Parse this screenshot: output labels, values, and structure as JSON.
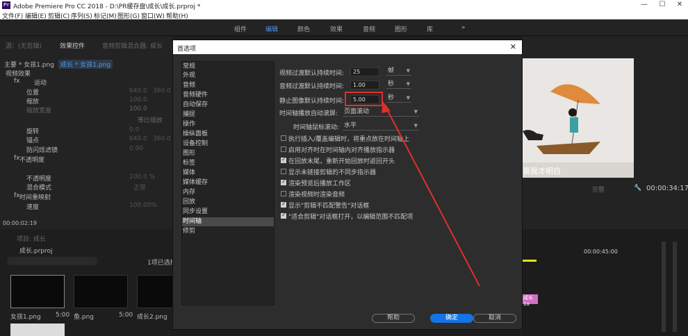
{
  "app": {
    "title": "Adobe Premiere Pro CC 2018 - D:\\PR缓存盘\\成长\\成长.prproj *",
    "logo": "Pr",
    "min": "—",
    "max": "☐",
    "close": "✕"
  },
  "menu": [
    "文件(F)",
    "编辑(E)",
    "剪辑(C)",
    "序列(S)",
    "标记(M)",
    "图形(G)",
    "窗口(W)",
    "帮助(H)"
  ],
  "workspaces": [
    "组件",
    "编辑",
    "颜色",
    "效果",
    "音频",
    "图形",
    "库"
  ],
  "workspace_more": "»",
  "effects_panel": {
    "tab1": "源：(无剪辑)",
    "tab2": "效果控件",
    "tab3": "音频剪辑混合器: 成长",
    "seq_label": "主要 * 女孩1.png",
    "seq_clip": "成长 * 女孩1.png",
    "video_effects": "视频效果",
    "motion": "运动",
    "position": "位置",
    "pos_x": "640.0",
    "pos_y": "360.0",
    "scale": "缩放",
    "scale_v": "100.0",
    "scale_w": "缩放宽度",
    "scale_w_v": "100.0",
    "uniform": "等比缩放",
    "rotation": "旋转",
    "rot_v": "0.0",
    "anchor": "锚点",
    "anc_x": "640.0",
    "anc_y": "360.0",
    "flicker": "防闪烁滤镜",
    "flick_v": "0.00",
    "opacity": "不透明度",
    "opacity_sub": "不透明度",
    "opacity_v": "100.0 %",
    "blend": "混合模式",
    "blend_v": "正常",
    "time_remap": "时间重映射",
    "speed": "速度",
    "speed_v": "100.00%",
    "timecode": "00:00:02:19"
  },
  "project_panel": {
    "tab": "项目: 成长",
    "name": "成长.prproj",
    "selected": "1项已选择",
    "clips": [
      {
        "name": "女孩1.png",
        "dur": "5:00"
      },
      {
        "name": "鱼.png",
        "dur": "5:00"
      },
      {
        "name": "成长2.png",
        "dur": "5:00"
      }
    ]
  },
  "program": {
    "subtitle": "喜我才明白",
    "timecode": "00:00:34:17",
    "fit": "完整",
    "ruler": "00:00:45:00",
    "clip_label": "成长1a"
  },
  "dialog": {
    "title": "首选项",
    "close": "✕",
    "categories": [
      "常规",
      "外观",
      "音频",
      "音频硬件",
      "自动保存",
      "捕捉",
      "操作",
      "操纵面板",
      "设备控制",
      "图形",
      "标签",
      "媒体",
      "媒体缓存",
      "内存",
      "回放",
      "同步设置",
      "时间轴",
      "修剪"
    ],
    "selected_category": "时间轴",
    "settings": {
      "video_transition_label": "视频过渡默认持续时间:",
      "video_transition_value": "25",
      "video_transition_unit": "帧",
      "audio_transition_label": "音频过渡默认持续时间:",
      "audio_transition_value": "1.00",
      "audio_transition_unit": "秒",
      "still_image_label": "静止图像默认持续时间:",
      "still_image_value": "5.00",
      "still_image_unit": "秒",
      "auto_scroll_label": "时间轴播放自动滚屏:",
      "auto_scroll_value": "页面滚动",
      "mouse_scroll_label": "时间轴鼠标滚动:",
      "mouse_scroll_value": "水平"
    },
    "checkboxes": [
      {
        "label": "执行插入/覆盖编辑时，将重点放在时间轴上",
        "checked": false
      },
      {
        "label": "启用对齐时在时间轴内对齐播放指示器",
        "checked": false
      },
      {
        "label": "在回放末尾，重新开始回放时返回开头",
        "checked": true
      },
      {
        "label": "显示未链接剪辑的不同步指示器",
        "checked": false
      },
      {
        "label": "渲染预览后播放工作区",
        "checked": true
      },
      {
        "label": "渲染视频时渲染音频",
        "checked": false
      },
      {
        "label": "显示\"剪辑不匹配警告\"对话框",
        "checked": true
      },
      {
        "label": "\"适合剪辑\"对话框打开，以编辑范围不匹配项",
        "checked": true
      }
    ],
    "help_btn": "帮助",
    "ok_btn": "确定",
    "cancel_btn": "取消"
  },
  "colors": {
    "accent": "#1473e6",
    "workspace_active": "#4e97e8",
    "highlight": "#e0302a",
    "arrow": "#e0302a"
  }
}
